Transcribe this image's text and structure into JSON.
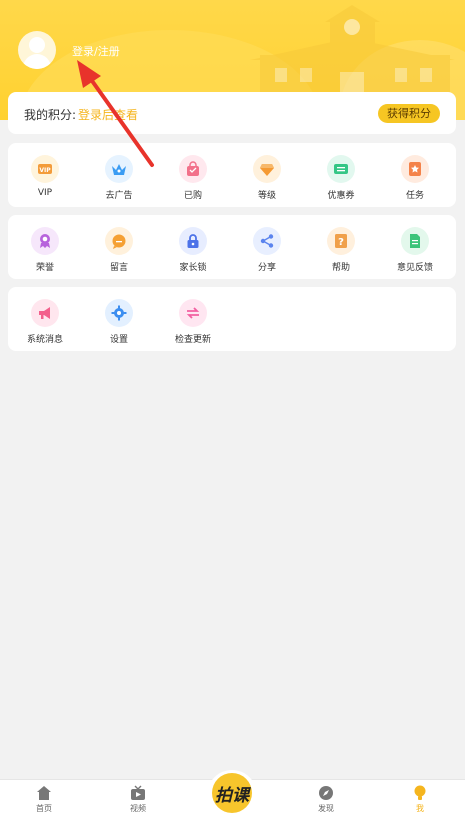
{
  "header": {
    "login_text": "登录/注册"
  },
  "points": {
    "label": "我的积分:",
    "value": "登录后查看",
    "earn_button": "获得积分"
  },
  "row1": [
    {
      "label": "VIP",
      "icon": "vip-icon",
      "bg": "#fff4dc",
      "color": "#f39c3a"
    },
    {
      "label": "去广告",
      "icon": "crown-icon",
      "bg": "#e6f3ff",
      "color": "#3a9cf3"
    },
    {
      "label": "已购",
      "icon": "bag-icon",
      "bg": "#ffe8ee",
      "color": "#f2708a"
    },
    {
      "label": "等级",
      "icon": "diamond-icon",
      "bg": "#fff1dc",
      "color": "#f59a33"
    },
    {
      "label": "优惠券",
      "icon": "coupon-icon",
      "bg": "#e2f8ef",
      "color": "#34c686"
    },
    {
      "label": "任务",
      "icon": "task-icon",
      "bg": "#ffebdf",
      "color": "#f4834a"
    }
  ],
  "row2": [
    {
      "label": "荣誉",
      "icon": "medal-icon",
      "bg": "#f6e7fb",
      "color": "#b763dc"
    },
    {
      "label": "留言",
      "icon": "comment-icon",
      "bg": "#fff1dc",
      "color": "#f5a033"
    },
    {
      "label": "家长锁",
      "icon": "lock-icon",
      "bg": "#e7edff",
      "color": "#4c72e8"
    },
    {
      "label": "分享",
      "icon": "share-icon",
      "bg": "#e8efff",
      "color": "#5b84ee"
    },
    {
      "label": "帮助",
      "icon": "help-icon",
      "bg": "#fff0dd",
      "color": "#f0a04a"
    },
    {
      "label": "意见反馈",
      "icon": "feedback-icon",
      "bg": "#e3f8ec",
      "color": "#3cc47a"
    }
  ],
  "row3": [
    {
      "label": "系统消息",
      "icon": "megaphone-icon",
      "bg": "#ffe6ee",
      "color": "#f3608c"
    },
    {
      "label": "设置",
      "icon": "gear-icon",
      "bg": "#e3f0ff",
      "color": "#3c8ef0"
    },
    {
      "label": "检查更新",
      "icon": "refresh-icon",
      "bg": "#ffe6f1",
      "color": "#f25fa1"
    }
  ],
  "nav": {
    "home": "首页",
    "video": "视频",
    "center": "拍课",
    "discover": "发现",
    "me": "我"
  },
  "colors": {
    "accent": "#f6c623",
    "header": "#ffd43a",
    "arrow": "#e8332b"
  }
}
